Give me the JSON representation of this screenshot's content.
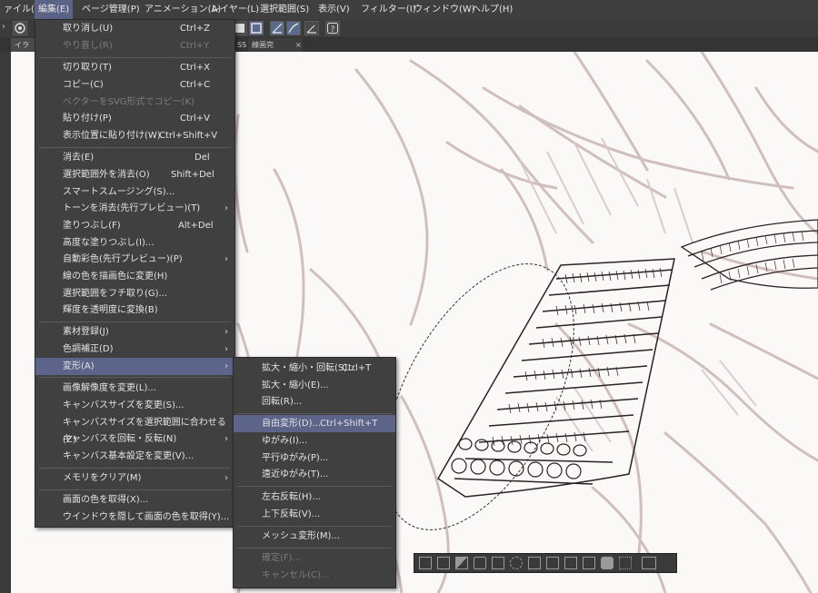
{
  "menubar": {
    "items": [
      {
        "label": "ァイル(F)"
      },
      {
        "label": "編集(E)"
      },
      {
        "label": "ページ管理(P)"
      },
      {
        "label": "アニメーション(A)"
      },
      {
        "label": "レイヤー(L)"
      },
      {
        "label": "選択範囲(S)"
      },
      {
        "label": "表示(V)"
      },
      {
        "label": "フィルター(I)"
      },
      {
        "label": "ウィンドウ(W)"
      },
      {
        "label": "ヘルプ(H)"
      }
    ],
    "active_index": 1
  },
  "tabs": [
    {
      "label": "イラスト"
    },
    {
      "label": "SS"
    },
    {
      "label": "線画完成.p..."
    },
    {
      "label": "×"
    }
  ],
  "edit_menu": {
    "items": [
      {
        "label": "取り消し(U)",
        "shortcut": "Ctrl+Z",
        "disabled": false
      },
      {
        "label": "やり直し(R)",
        "shortcut": "Ctrl+Y",
        "disabled": true
      },
      {
        "label": "切り取り(T)",
        "shortcut": "Ctrl+X",
        "disabled": false
      },
      {
        "label": "コピー(C)",
        "shortcut": "Ctrl+C",
        "disabled": false
      },
      {
        "label": "ベクターをSVG形式でコピー(K)",
        "shortcut": "",
        "disabled": true
      },
      {
        "label": "貼り付け(P)",
        "shortcut": "Ctrl+V",
        "disabled": false
      },
      {
        "label": "表示位置に貼り付け(W)",
        "shortcut": "Ctrl+Shift+V",
        "disabled": false
      },
      {
        "label": "消去(E)",
        "shortcut": "Del",
        "disabled": false
      },
      {
        "label": "選択範囲外を消去(O)",
        "shortcut": "Shift+Del",
        "disabled": false
      },
      {
        "label": "スマートスムージング(S)...",
        "shortcut": "",
        "disabled": false
      },
      {
        "label": "トーンを消去(先行プレビュー)(T)",
        "shortcut": "",
        "disabled": false,
        "submenu": true
      },
      {
        "label": "塗りつぶし(F)",
        "shortcut": "Alt+Del",
        "disabled": false
      },
      {
        "label": "高度な塗りつぶし(I)...",
        "shortcut": "",
        "disabled": false
      },
      {
        "label": "自動彩色(先行プレビュー)(P)",
        "shortcut": "",
        "disabled": false,
        "submenu": true
      },
      {
        "label": "線の色を描画色に変更(H)",
        "shortcut": "",
        "disabled": false
      },
      {
        "label": "選択範囲をフチ取り(G)...",
        "shortcut": "",
        "disabled": false
      },
      {
        "label": "輝度を透明度に変換(B)",
        "shortcut": "",
        "disabled": false
      },
      {
        "label": "素材登録(J)",
        "shortcut": "",
        "disabled": false,
        "submenu": true
      },
      {
        "label": "色調補正(D)",
        "shortcut": "",
        "disabled": false,
        "submenu": true
      },
      {
        "label": "変形(A)",
        "shortcut": "",
        "disabled": false,
        "submenu": true,
        "highlighted": true
      },
      {
        "label": "画像解像度を変更(L)...",
        "shortcut": "",
        "disabled": false
      },
      {
        "label": "キャンバスサイズを変更(S)...",
        "shortcut": "",
        "disabled": false
      },
      {
        "label": "キャンバスサイズを選択範囲に合わせる(Z)",
        "shortcut": "",
        "disabled": false
      },
      {
        "label": "キャンバスを回転・反転(N)",
        "shortcut": "",
        "disabled": false,
        "submenu": true
      },
      {
        "label": "キャンバス基本設定を変更(V)...",
        "shortcut": "",
        "disabled": false
      },
      {
        "label": "メモリをクリア(M)",
        "shortcut": "",
        "disabled": false,
        "submenu": true
      },
      {
        "label": "画面の色を取得(X)...",
        "shortcut": "",
        "disabled": false
      },
      {
        "label": "ウインドウを隠して画面の色を取得(Y)...",
        "shortcut": "",
        "disabled": false
      }
    ]
  },
  "transform_submenu": {
    "items": [
      {
        "label": "拡大・縮小・回転(S)...",
        "shortcut": "Ctrl+T",
        "disabled": false
      },
      {
        "label": "拡大・縮小(E)...",
        "shortcut": "",
        "disabled": false
      },
      {
        "label": "回転(R)...",
        "shortcut": "",
        "disabled": false
      },
      {
        "label": "自由変形(D)...",
        "shortcut": "Ctrl+Shift+T",
        "disabled": false,
        "highlighted": true
      },
      {
        "label": "ゆがみ(I)...",
        "shortcut": "",
        "disabled": false
      },
      {
        "label": "平行ゆがみ(P)...",
        "shortcut": "",
        "disabled": false
      },
      {
        "label": "遠近ゆがみ(T)...",
        "shortcut": "",
        "disabled": false
      },
      {
        "label": "左右反転(H)...",
        "shortcut": "",
        "disabled": false
      },
      {
        "label": "上下反転(V)...",
        "shortcut": "",
        "disabled": false
      },
      {
        "label": "メッシュ変形(M)...",
        "shortcut": "",
        "disabled": false
      },
      {
        "label": "確定(F)...",
        "shortcut": "",
        "disabled": true
      },
      {
        "label": "キャンセル(C)...",
        "shortcut": "",
        "disabled": true
      }
    ]
  },
  "colors": {
    "menu_bg": "#404040",
    "highlight": "#5c648a",
    "disabled_text": "#7c7c7c",
    "sketch_line": "#bfa9a6",
    "ink_line": "#2b2222"
  }
}
